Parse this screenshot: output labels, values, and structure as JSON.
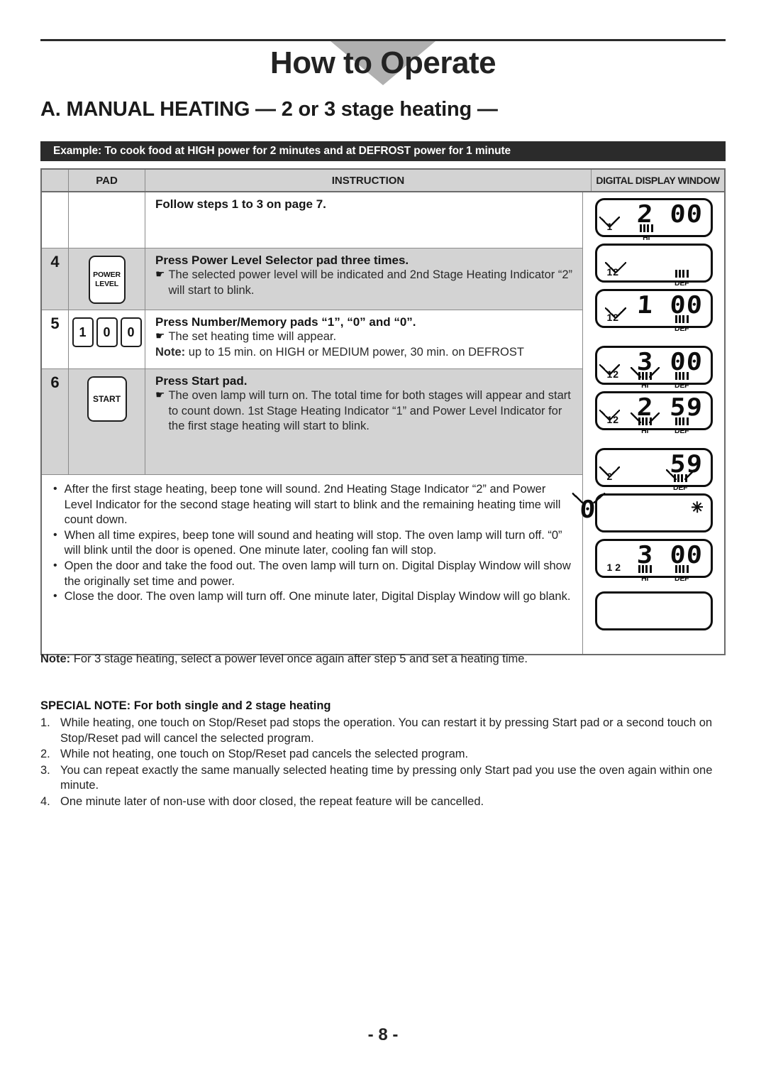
{
  "header": {
    "title": "How to Operate",
    "section_heading": "A. MANUAL HEATING — 2 or 3 stage heating —",
    "example_bar": "Example:  To cook food at HIGH power for 2 minutes and at DEFROST power for 1 minute"
  },
  "table": {
    "columns": {
      "step": "",
      "pad": "PAD",
      "instruction": "INSTRUCTION",
      "display": "DIGITAL DISPLAY WINDOW"
    },
    "rows": [
      {
        "step": "",
        "pad": null,
        "instruction_title": "Follow steps 1 to 3 on page 7.",
        "instruction_lines": [],
        "shaded": false
      },
      {
        "step": "4",
        "pad": {
          "type": "power-level",
          "label_line1": "POWER",
          "label_line2": "LEVEL"
        },
        "instruction_title": "Press Power Level Selector pad three times.",
        "instruction_lines": [
          "The selected power level will be indicated and 2nd Stage Heating Indicator “2” will start to blink."
        ],
        "shaded": true
      },
      {
        "step": "5",
        "pad": {
          "type": "number-pads",
          "keys": [
            "1",
            "0",
            "0"
          ]
        },
        "instruction_title": "Press Number/Memory pads “1”, “0” and “0”.",
        "instruction_lines": [
          "The set heating time will appear."
        ],
        "note_label": "Note:",
        "note_text": "up to 15 min. on HIGH or MEDIUM power, 30 min. on DEFROST",
        "shaded": false
      },
      {
        "step": "6",
        "pad": {
          "type": "start",
          "label": "START"
        },
        "instruction_title": "Press Start pad.",
        "instruction_lines": [
          "The oven lamp will turn on. The total time for both stages will appear and start to count down. 1st Stage Heating Indicator “1” and Power Level Indicator for the first stage heating will start to blink."
        ],
        "shaded": true
      }
    ],
    "bullets": [
      "After the first stage heating, beep tone will sound. 2nd Heating Stage Indicator “2” and Power Level Indicator for the second stage heating will start to blink and the remaining heating time will count down.",
      "When all time expires, beep tone will sound and heating will stop. The oven lamp will turn off. “0” will blink until the door is opened. One minute later, cooling fan will stop.",
      "Open the door and take the food out. The oven lamp will turn on. Digital Display Window will show the originally set time and power.",
      "Close the door. The oven lamp will turn off. One minute later, Digital Display Window will go blank."
    ]
  },
  "displays": [
    {
      "id": "d1",
      "digits": "2 00",
      "stage": [
        "1"
      ],
      "blinking_stage": [
        "1"
      ],
      "power_bars": [
        {
          "label": "HI",
          "blinking": false
        }
      ]
    },
    {
      "id": "d2",
      "digits": "",
      "stage": [
        "1",
        "2"
      ],
      "blinking_stage": [
        "2"
      ],
      "power_bars": [
        {
          "label": "DEF",
          "blinking": false
        }
      ]
    },
    {
      "id": "d3",
      "digits": "1 00",
      "stage": [
        "1",
        "2"
      ],
      "blinking_stage": [
        "2"
      ],
      "power_bars": [
        {
          "label": "DEF",
          "blinking": false
        }
      ]
    },
    {
      "id": "d4",
      "digits": "3 00",
      "stage": [
        "1",
        "2"
      ],
      "blinking_stage": [
        "1"
      ],
      "power_bars": [
        {
          "label": "HI",
          "blinking": true
        },
        {
          "label": "DEF",
          "blinking": false
        }
      ]
    },
    {
      "id": "d5",
      "digits": "2 59",
      "stage": [
        "1",
        "2"
      ],
      "blinking_stage": [
        "1"
      ],
      "power_bars": [
        {
          "label": "HI",
          "blinking": true
        },
        {
          "label": "DEF",
          "blinking": false
        }
      ]
    },
    {
      "id": "d6",
      "digits": "59",
      "stage": [
        "2"
      ],
      "blinking_stage": [
        "2"
      ],
      "power_bars": [
        {
          "label": "DEF",
          "blinking": true
        }
      ]
    },
    {
      "id": "d7",
      "digits": "0",
      "stage": [],
      "blinking_stage": [],
      "blinking_digits": true,
      "power_bars": []
    },
    {
      "id": "d8",
      "digits": "3 00",
      "stage": [
        "1",
        "2"
      ],
      "blinking_stage": [],
      "power_bars": [
        {
          "label": "HI",
          "blinking": false
        },
        {
          "label": "DEF",
          "blinking": false
        }
      ]
    },
    {
      "id": "d9",
      "digits": "",
      "stage": [],
      "blinking_stage": [],
      "power_bars": []
    }
  ],
  "footer": {
    "note_label": "Note:",
    "note_text": "For 3 stage heating, select a power level once again after step 5 and set a heating time.",
    "special_note_title": "SPECIAL NOTE: For both single and 2 stage heating",
    "numbered_items": [
      {
        "n": "1.",
        "text": "While heating, one touch on Stop/Reset pad stops the operation. You can restart it by pressing Start pad or a second touch on Stop/Reset pad will cancel the selected program."
      },
      {
        "n": "2.",
        "text": "While not heating, one touch on Stop/Reset pad cancels the selected program."
      },
      {
        "n": "3.",
        "text": "You can repeat exactly the same manually selected heating time by pressing only Start pad you use the oven again within one minute."
      },
      {
        "n": "4.",
        "text": "One minute later of non-use with door closed, the repeat feature will be cancelled."
      }
    ],
    "page_number": "- 8 -"
  },
  "colors": {
    "ink": "#232323",
    "shade": "#d3d3d3",
    "chevron": "#b0b0b0",
    "bar_bg": "#2b2b2b"
  }
}
